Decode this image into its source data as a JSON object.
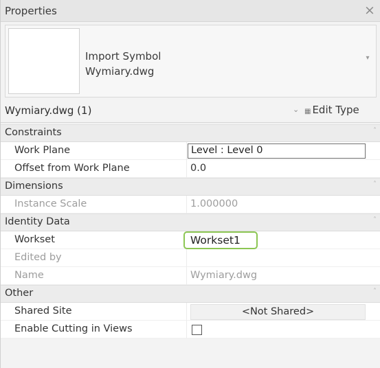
{
  "panel": {
    "title": "Properties",
    "close_glyph": "×"
  },
  "type_selector": {
    "family_line1": "Import Symbol",
    "family_line2": "Wymiary.dwg",
    "dropdown_glyph": "▾"
  },
  "instance_selector": {
    "label": "Wymiary.dwg (1)",
    "chevron": "⌄",
    "edit_type_icon": "▦",
    "edit_type_label": "Edit Type"
  },
  "groups": {
    "constraints": "Constraints",
    "dimensions": "Dimensions",
    "identity_data": "Identity Data",
    "other": "Other"
  },
  "group_mark": "˄",
  "properties": {
    "work_plane": {
      "name": "Work Plane",
      "value": "Level : Level 0"
    },
    "offset": {
      "name": "Offset from Work Plane",
      "value": "0.0"
    },
    "instance_scale": {
      "name": "Instance Scale",
      "value": "1.000000"
    },
    "workset": {
      "name": "Workset",
      "value": "Workset1"
    },
    "edited_by": {
      "name": "Edited by",
      "value": ""
    },
    "name": {
      "name": "Name",
      "value": "Wymiary.dwg"
    },
    "shared_site": {
      "name": "Shared Site",
      "value": "<Not Shared>"
    },
    "enable_cutting": {
      "name": "Enable Cutting in Views",
      "checked": false
    }
  },
  "colors": {
    "highlight": "#8cc653"
  }
}
